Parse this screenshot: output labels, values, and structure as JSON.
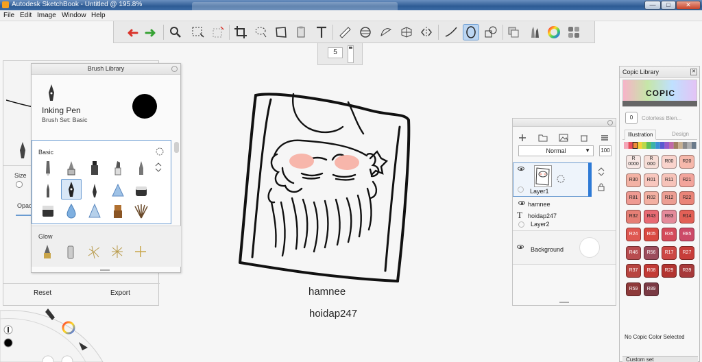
{
  "window": {
    "title": "Autodesk SketchBook - Untitled @ 195.8%",
    "minimize": "—",
    "maximize": "□",
    "close": "✕"
  },
  "menu": [
    "File",
    "Edit",
    "Image",
    "Window",
    "Help"
  ],
  "toolbar": {
    "tools": [
      "undo-icon",
      "redo-icon",
      "zoom-icon",
      "select-icon",
      "crop-select-icon",
      "crop-icon",
      "lasso-icon",
      "transform-icon",
      "bucket-icon",
      "text-icon",
      "ruler-icon",
      "ellipse-guide-icon",
      "french-curve-icon",
      "perspective-icon",
      "symmetry-icon",
      "stroke-icon",
      "ellipse-icon",
      "shapes-icon",
      "layer-copy-icon",
      "brush-palette-icon",
      "color-wheel-icon",
      "copic-icon"
    ],
    "brush_size": "5"
  },
  "brush_properties": {
    "size_label": "Size",
    "opacity_label": "Opacit",
    "reset": "Reset",
    "export": "Export"
  },
  "brush_library": {
    "title": "Brush Library",
    "brush_name": "Inking Pen",
    "brush_set": "Brush Set: Basic",
    "section_basic": "Basic",
    "section_glow": "Glow"
  },
  "canvas": {
    "text_1": "hamnee",
    "text_2": "hoidap247"
  },
  "layers": {
    "blend_mode": "Normal",
    "opacity": "100",
    "items": [
      {
        "name": "Layer1"
      },
      {
        "name": "hamnee"
      },
      {
        "name": "hoidap247"
      },
      {
        "name": "Layer2"
      },
      {
        "name": "Background"
      }
    ]
  },
  "copic": {
    "title": "Copic Library",
    "logo": "COPIC",
    "colorless_code": "0",
    "colorless_name": "Colorless Blen...",
    "tab_illustration": "Illustration",
    "tab_design": "Design",
    "swatches": [
      "R\n0000",
      "R\n000",
      "R00",
      "R20",
      "R30",
      "R01",
      "R11",
      "R21",
      "R81",
      "R02",
      "R12",
      "R22",
      "R32",
      "R43",
      "R83",
      "R14",
      "R24",
      "R05",
      "R35",
      "R85",
      "R46",
      "R56",
      "R17",
      "R27",
      "R37",
      "R08",
      "R29",
      "R39",
      "R59",
      "R89"
    ],
    "swatch_colors": [
      "#f7e7e4",
      "#f6ddd6",
      "#f9d3cc",
      "#f6b8ab",
      "#f3b2a4",
      "#f8c7be",
      "#f6c3b9",
      "#f2a49b",
      "#ef9a92",
      "#f3b0a2",
      "#ec9e93",
      "#ea8478",
      "#e57f75",
      "#e76a73",
      "#e48a9a",
      "#e26056",
      "#df5851",
      "#d94a41",
      "#d44a5a",
      "#cc4a68",
      "#b84c4f",
      "#9c4d5c",
      "#cc4844",
      "#c73d3a",
      "#b8443f",
      "#c23a35",
      "#b23430",
      "#a73a3b",
      "#8e3a3a",
      "#7a3a44"
    ],
    "no_color_text": "No Copic Color Selected",
    "custom_set": "Custom set"
  }
}
